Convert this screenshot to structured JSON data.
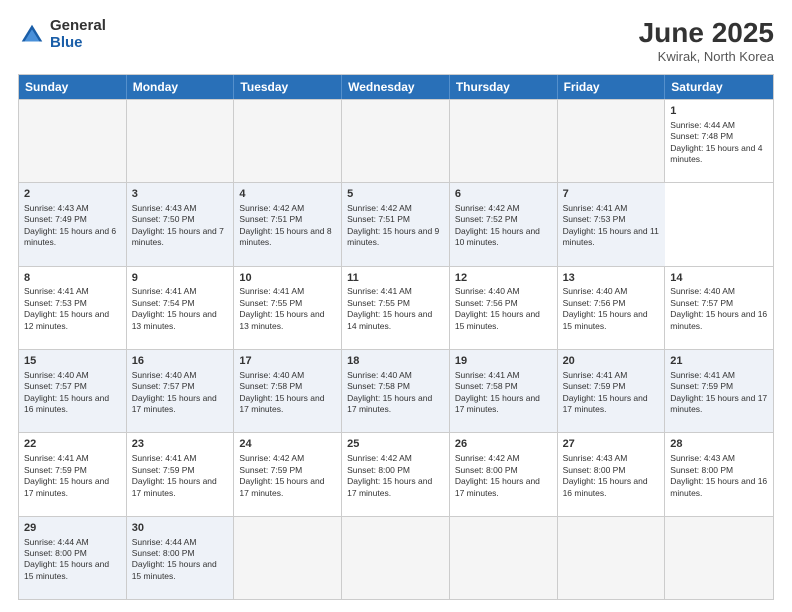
{
  "header": {
    "logo_general": "General",
    "logo_blue": "Blue",
    "title": "June 2025",
    "subtitle": "Kwirak, North Korea"
  },
  "calendar": {
    "days": [
      "Sunday",
      "Monday",
      "Tuesday",
      "Wednesday",
      "Thursday",
      "Friday",
      "Saturday"
    ],
    "weeks": [
      [
        {
          "day": null,
          "text": ""
        },
        {
          "day": null,
          "text": ""
        },
        {
          "day": null,
          "text": ""
        },
        {
          "day": null,
          "text": ""
        },
        {
          "day": null,
          "text": ""
        },
        {
          "day": null,
          "text": ""
        },
        {
          "day": "1",
          "text": "Sunrise: 4:44 AM\nSunset: 7:48 PM\nDaylight: 15 hours and 4 minutes."
        }
      ],
      [
        {
          "day": "2",
          "text": "Sunrise: 4:43 AM\nSunset: 7:49 PM\nDaylight: 15 hours and 6 minutes."
        },
        {
          "day": "3",
          "text": "Sunrise: 4:43 AM\nSunset: 7:50 PM\nDaylight: 15 hours and 7 minutes."
        },
        {
          "day": "4",
          "text": "Sunrise: 4:42 AM\nSunset: 7:51 PM\nDaylight: 15 hours and 8 minutes."
        },
        {
          "day": "5",
          "text": "Sunrise: 4:42 AM\nSunset: 7:51 PM\nDaylight: 15 hours and 9 minutes."
        },
        {
          "day": "6",
          "text": "Sunrise: 4:42 AM\nSunset: 7:52 PM\nDaylight: 15 hours and 10 minutes."
        },
        {
          "day": "7",
          "text": "Sunrise: 4:41 AM\nSunset: 7:53 PM\nDaylight: 15 hours and 11 minutes."
        }
      ],
      [
        {
          "day": "8",
          "text": "Sunrise: 4:41 AM\nSunset: 7:53 PM\nDaylight: 15 hours and 12 minutes."
        },
        {
          "day": "9",
          "text": "Sunrise: 4:41 AM\nSunset: 7:54 PM\nDaylight: 15 hours and 13 minutes."
        },
        {
          "day": "10",
          "text": "Sunrise: 4:41 AM\nSunset: 7:55 PM\nDaylight: 15 hours and 13 minutes."
        },
        {
          "day": "11",
          "text": "Sunrise: 4:41 AM\nSunset: 7:55 PM\nDaylight: 15 hours and 14 minutes."
        },
        {
          "day": "12",
          "text": "Sunrise: 4:40 AM\nSunset: 7:56 PM\nDaylight: 15 hours and 15 minutes."
        },
        {
          "day": "13",
          "text": "Sunrise: 4:40 AM\nSunset: 7:56 PM\nDaylight: 15 hours and 15 minutes."
        },
        {
          "day": "14",
          "text": "Sunrise: 4:40 AM\nSunset: 7:57 PM\nDaylight: 15 hours and 16 minutes."
        }
      ],
      [
        {
          "day": "15",
          "text": "Sunrise: 4:40 AM\nSunset: 7:57 PM\nDaylight: 15 hours and 16 minutes."
        },
        {
          "day": "16",
          "text": "Sunrise: 4:40 AM\nSunset: 7:57 PM\nDaylight: 15 hours and 17 minutes."
        },
        {
          "day": "17",
          "text": "Sunrise: 4:40 AM\nSunset: 7:58 PM\nDaylight: 15 hours and 17 minutes."
        },
        {
          "day": "18",
          "text": "Sunrise: 4:40 AM\nSunset: 7:58 PM\nDaylight: 15 hours and 17 minutes."
        },
        {
          "day": "19",
          "text": "Sunrise: 4:41 AM\nSunset: 7:58 PM\nDaylight: 15 hours and 17 minutes."
        },
        {
          "day": "20",
          "text": "Sunrise: 4:41 AM\nSunset: 7:59 PM\nDaylight: 15 hours and 17 minutes."
        },
        {
          "day": "21",
          "text": "Sunrise: 4:41 AM\nSunset: 7:59 PM\nDaylight: 15 hours and 17 minutes."
        }
      ],
      [
        {
          "day": "22",
          "text": "Sunrise: 4:41 AM\nSunset: 7:59 PM\nDaylight: 15 hours and 17 minutes."
        },
        {
          "day": "23",
          "text": "Sunrise: 4:41 AM\nSunset: 7:59 PM\nDaylight: 15 hours and 17 minutes."
        },
        {
          "day": "24",
          "text": "Sunrise: 4:42 AM\nSunset: 7:59 PM\nDaylight: 15 hours and 17 minutes."
        },
        {
          "day": "25",
          "text": "Sunrise: 4:42 AM\nSunset: 8:00 PM\nDaylight: 15 hours and 17 minutes."
        },
        {
          "day": "26",
          "text": "Sunrise: 4:42 AM\nSunset: 8:00 PM\nDaylight: 15 hours and 17 minutes."
        },
        {
          "day": "27",
          "text": "Sunrise: 4:43 AM\nSunset: 8:00 PM\nDaylight: 15 hours and 16 minutes."
        },
        {
          "day": "28",
          "text": "Sunrise: 4:43 AM\nSunset: 8:00 PM\nDaylight: 15 hours and 16 minutes."
        }
      ],
      [
        {
          "day": "29",
          "text": "Sunrise: 4:44 AM\nSunset: 8:00 PM\nDaylight: 15 hours and 15 minutes."
        },
        {
          "day": "30",
          "text": "Sunrise: 4:44 AM\nSunset: 8:00 PM\nDaylight: 15 hours and 15 minutes."
        },
        {
          "day": null,
          "text": ""
        },
        {
          "day": null,
          "text": ""
        },
        {
          "day": null,
          "text": ""
        },
        {
          "day": null,
          "text": ""
        },
        {
          "day": null,
          "text": ""
        }
      ]
    ]
  }
}
